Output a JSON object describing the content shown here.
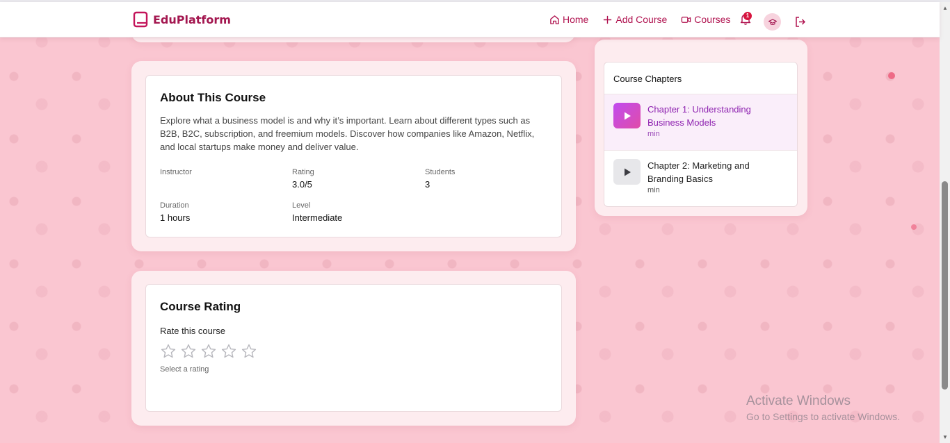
{
  "brand": {
    "name": "EduPlatform",
    "color": "#a3164f"
  },
  "nav": {
    "links": [
      {
        "label": "Home",
        "icon": "home-icon"
      },
      {
        "label": "Add Course",
        "icon": "plus-icon"
      },
      {
        "label": "Courses",
        "icon": "video-icon"
      }
    ],
    "notifications_count": "1",
    "avatar_icon": "graduation-cap-icon",
    "logout_icon": "logout-icon"
  },
  "about": {
    "title": "About This Course",
    "description": "Explore what a business model is and why it’s important. Learn about different types such as B2B, B2C, subscription, and freemium models. Discover how companies like Amazon, Netflix, and local startups make money and deliver value.",
    "meta": [
      {
        "label": "Instructor",
        "value": ""
      },
      {
        "label": "Rating",
        "value": "3.0/5"
      },
      {
        "label": "Students",
        "value": "3"
      },
      {
        "label": "Duration",
        "value": "1 hours"
      },
      {
        "label": "Level",
        "value": "Intermediate"
      }
    ]
  },
  "rating": {
    "title": "Course Rating",
    "prompt": "Rate this course",
    "hint": "Select a rating",
    "selected_stars": 0,
    "max_stars": 5
  },
  "chapters": {
    "title": "Course Chapters",
    "items": [
      {
        "title": "Chapter 1: Understanding Business Models",
        "duration": "min",
        "active": true
      },
      {
        "title": "Chapter 2: Marketing and Branding Basics",
        "duration": "min",
        "active": false
      }
    ]
  },
  "watermark": {
    "title": "Activate Windows",
    "subtitle": "Go to Settings to activate Windows."
  },
  "colors": {
    "accent": "#b0124f",
    "background": "#fac6d1",
    "active_chapter": "#8e23b0"
  }
}
